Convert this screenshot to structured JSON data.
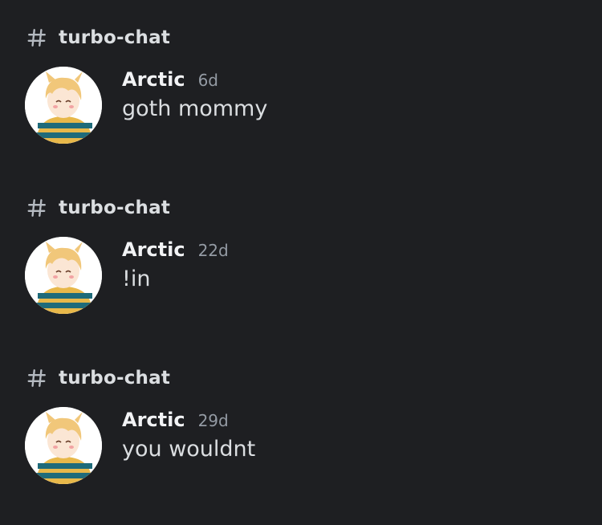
{
  "colors": {
    "background": "#1e1f22",
    "text_primary": "#f2f3f5",
    "text_secondary": "#dbdee1",
    "text_muted": "#949ba4"
  },
  "results": [
    {
      "channel_icon": "hash-icon",
      "channel": "turbo-chat",
      "avatar_icon": "user-avatar",
      "author": "Arctic",
      "time": "6d",
      "message": "goth mommy"
    },
    {
      "channel_icon": "hash-icon",
      "channel": "turbo-chat",
      "avatar_icon": "user-avatar",
      "author": "Arctic",
      "time": "22d",
      "message": "!in"
    },
    {
      "channel_icon": "hash-icon",
      "channel": "turbo-chat",
      "avatar_icon": "user-avatar",
      "author": "Arctic",
      "time": "29d",
      "message": "you wouldnt"
    }
  ]
}
